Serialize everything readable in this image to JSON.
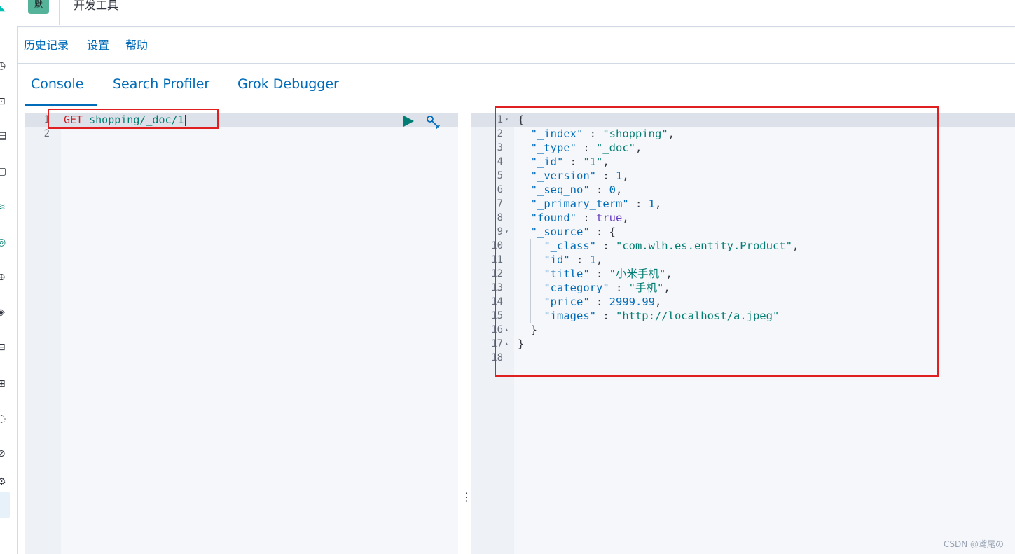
{
  "header": {
    "badge": "默",
    "title": "开发工具"
  },
  "rail": {
    "icons": [
      "clock-icon",
      "discover-icon",
      "dashboard-icon",
      "canvas-icon",
      "maps-icon",
      "ml-icon",
      "observability-icon",
      "security-icon",
      "fleet-icon",
      "stack-icon",
      "dev-tools-icon",
      "management-icon",
      "settings-icon"
    ]
  },
  "menu": {
    "items": [
      "历史记录",
      "设置",
      "帮助"
    ]
  },
  "tabs": [
    "Console",
    "Search Profiler",
    "Grok Debugger"
  ],
  "request": {
    "line_numbers": [
      "1",
      "2"
    ],
    "method": "GET",
    "path": "shopping/_doc/1"
  },
  "response": {
    "lines": [
      {
        "n": "1",
        "fold": "▾",
        "indent": 0,
        "parts": [
          [
            "p",
            "{"
          ]
        ]
      },
      {
        "n": "2",
        "fold": "",
        "indent": 2,
        "parts": [
          [
            "k",
            "\"_index\""
          ],
          [
            "p",
            " : "
          ],
          [
            "s",
            "\"shopping\""
          ],
          [
            "p",
            ","
          ]
        ]
      },
      {
        "n": "3",
        "fold": "",
        "indent": 2,
        "parts": [
          [
            "k",
            "\"_type\""
          ],
          [
            "p",
            " : "
          ],
          [
            "s",
            "\"_doc\""
          ],
          [
            "p",
            ","
          ]
        ]
      },
      {
        "n": "4",
        "fold": "",
        "indent": 2,
        "parts": [
          [
            "k",
            "\"_id\""
          ],
          [
            "p",
            " : "
          ],
          [
            "s",
            "\"1\""
          ],
          [
            "p",
            ","
          ]
        ]
      },
      {
        "n": "5",
        "fold": "",
        "indent": 2,
        "parts": [
          [
            "k",
            "\"_version\""
          ],
          [
            "p",
            " : "
          ],
          [
            "n",
            "1"
          ],
          [
            "p",
            ","
          ]
        ]
      },
      {
        "n": "6",
        "fold": "",
        "indent": 2,
        "parts": [
          [
            "k",
            "\"_seq_no\""
          ],
          [
            "p",
            " : "
          ],
          [
            "n",
            "0"
          ],
          [
            "p",
            ","
          ]
        ]
      },
      {
        "n": "7",
        "fold": "",
        "indent": 2,
        "parts": [
          [
            "k",
            "\"_primary_term\""
          ],
          [
            "p",
            " : "
          ],
          [
            "n",
            "1"
          ],
          [
            "p",
            ","
          ]
        ]
      },
      {
        "n": "8",
        "fold": "",
        "indent": 2,
        "parts": [
          [
            "k",
            "\"found\""
          ],
          [
            "p",
            " : "
          ],
          [
            "b",
            "true"
          ],
          [
            "p",
            ","
          ]
        ]
      },
      {
        "n": "9",
        "fold": "▾",
        "indent": 2,
        "parts": [
          [
            "k",
            "\"_source\""
          ],
          [
            "p",
            " : {"
          ]
        ]
      },
      {
        "n": "10",
        "fold": "",
        "indent": 4,
        "parts": [
          [
            "k",
            "\"_class\""
          ],
          [
            "p",
            " : "
          ],
          [
            "s",
            "\"com.wlh.es.entity.Product\""
          ],
          [
            "p",
            ","
          ]
        ]
      },
      {
        "n": "11",
        "fold": "",
        "indent": 4,
        "parts": [
          [
            "k",
            "\"id\""
          ],
          [
            "p",
            " : "
          ],
          [
            "n",
            "1"
          ],
          [
            "p",
            ","
          ]
        ]
      },
      {
        "n": "12",
        "fold": "",
        "indent": 4,
        "parts": [
          [
            "k",
            "\"title\""
          ],
          [
            "p",
            " : "
          ],
          [
            "s",
            "\"小米手机\""
          ],
          [
            "p",
            ","
          ]
        ]
      },
      {
        "n": "13",
        "fold": "",
        "indent": 4,
        "parts": [
          [
            "k",
            "\"category\""
          ],
          [
            "p",
            " : "
          ],
          [
            "s",
            "\"手机\""
          ],
          [
            "p",
            ","
          ]
        ]
      },
      {
        "n": "14",
        "fold": "",
        "indent": 4,
        "parts": [
          [
            "k",
            "\"price\""
          ],
          [
            "p",
            " : "
          ],
          [
            "n",
            "2999.99"
          ],
          [
            "p",
            ","
          ]
        ]
      },
      {
        "n": "15",
        "fold": "",
        "indent": 4,
        "parts": [
          [
            "k",
            "\"images\""
          ],
          [
            "p",
            " : "
          ],
          [
            "s",
            "\"http://localhost/a.jpeg\""
          ]
        ]
      },
      {
        "n": "16",
        "fold": "▴",
        "indent": 2,
        "parts": [
          [
            "p",
            "}"
          ]
        ]
      },
      {
        "n": "17",
        "fold": "▴",
        "indent": 0,
        "parts": [
          [
            "p",
            "}"
          ]
        ]
      },
      {
        "n": "18",
        "fold": "",
        "indent": 0,
        "parts": []
      }
    ]
  },
  "watermark": "CSDN @鸢尾の"
}
